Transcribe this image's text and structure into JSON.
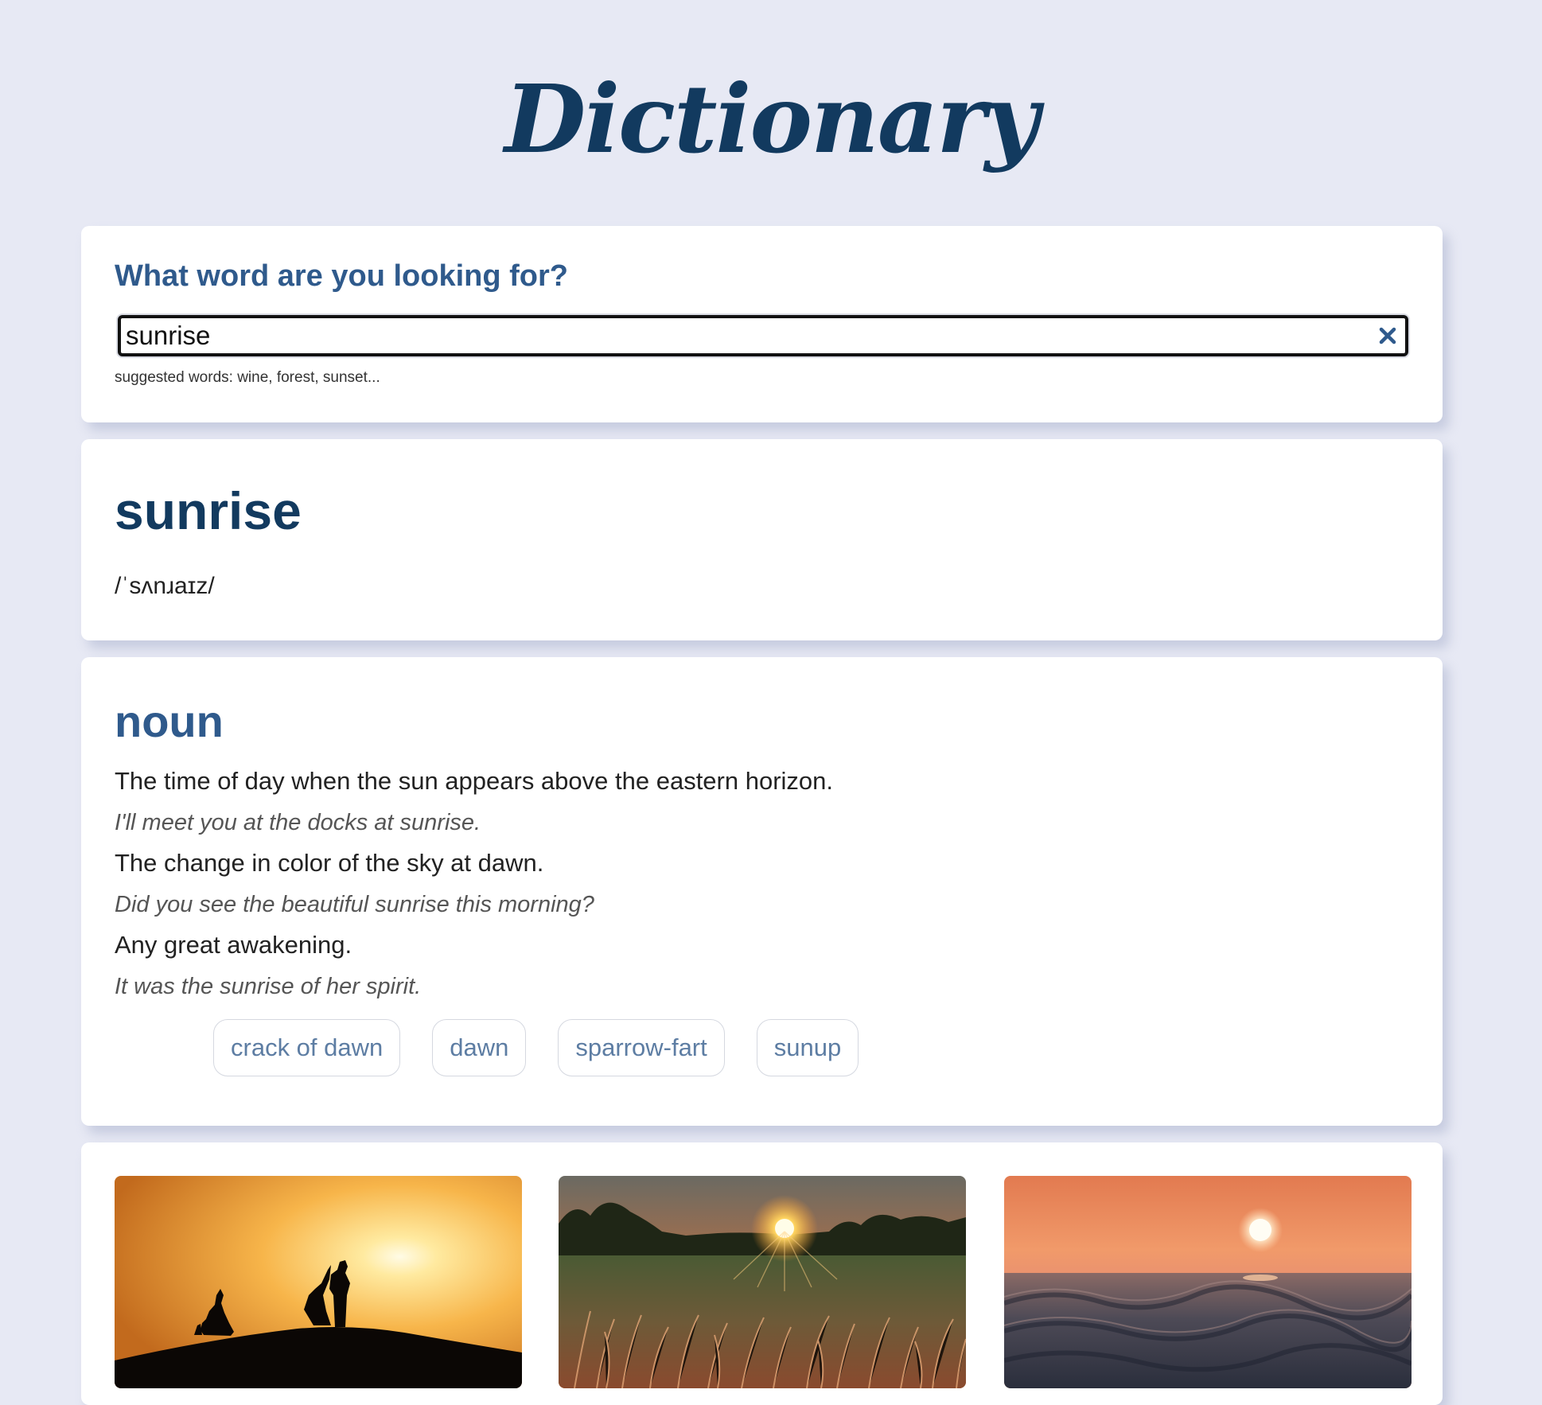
{
  "app": {
    "title": "Dictionary"
  },
  "search": {
    "heading": "What word are you looking for?",
    "value": "sunrise",
    "suggestions": "suggested words: wine, forest, sunset..."
  },
  "word": {
    "text": "sunrise",
    "phonetic": "/ˈsʌnɹaɪz/"
  },
  "meaning": {
    "part_of_speech": "noun",
    "definitions": [
      {
        "definition": "The time of day when the sun appears above the eastern horizon.",
        "example": "I'll meet you at the docks at sunrise."
      },
      {
        "definition": "The change in color of the sky at dawn.",
        "example": "Did you see the beautiful sunrise this morning?"
      },
      {
        "definition": "Any great awakening.",
        "example": "It was the sunrise of her spirit."
      }
    ],
    "synonyms": [
      "crack of dawn",
      "dawn",
      "sparrow-fart",
      "sunup"
    ]
  },
  "icons": {
    "clear": "close-icon"
  },
  "colors": {
    "background": "#e7e9f4",
    "title": "#123a5f",
    "accent": "#2f5a8c",
    "synonym_text": "#5d7da3"
  }
}
